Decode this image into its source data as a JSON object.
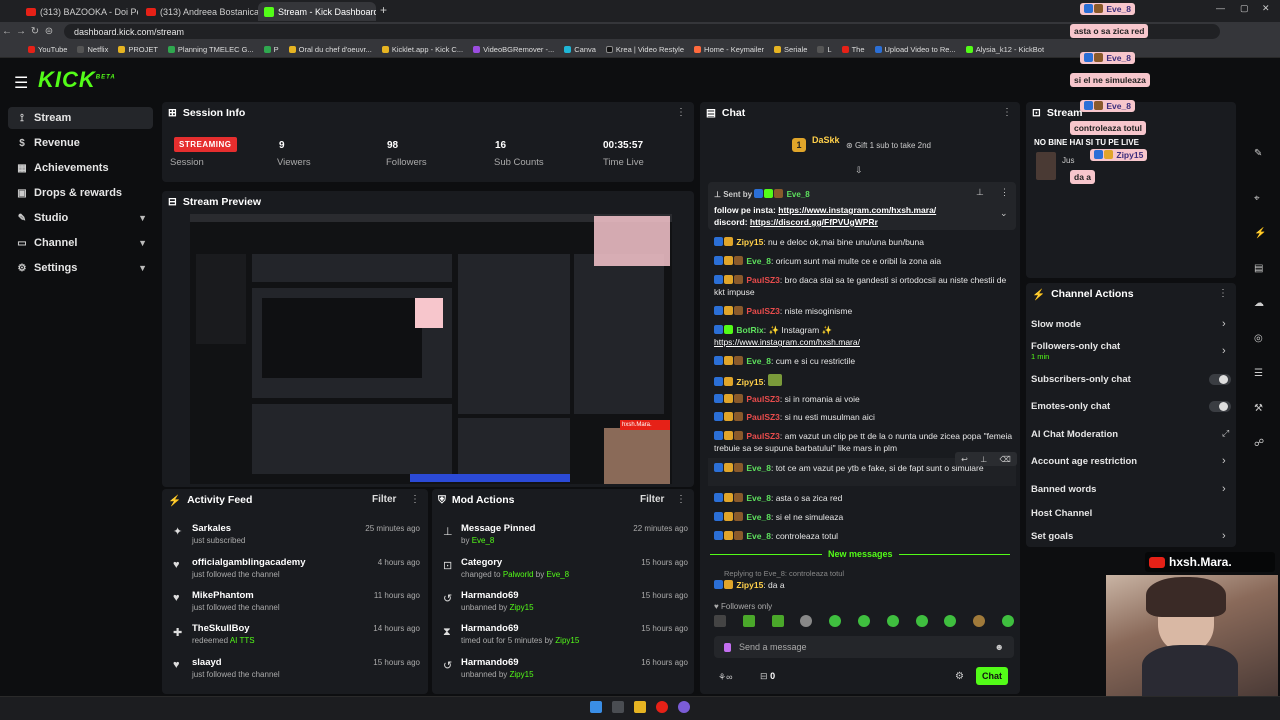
{
  "browser": {
    "tabs": [
      {
        "title": "(313) BAZOOKA - Doi Penali - Y"
      },
      {
        "title": "(313) Andreea Bostanica a Fos"
      },
      {
        "title": "Stream - Kick Dashboard"
      }
    ],
    "url": "dashboard.kick.com/stream",
    "bookmarks": [
      "YouTube",
      "Netflix",
      "PROJET",
      "Planning TMELEC G...",
      "P",
      "Oral du chef d'oeuvr...",
      "Kicklet.app - Kick C...",
      "VideoBGRemover -...",
      "Canva",
      "Krea | Video Restyle",
      "Home - Keymailer",
      "Seriale",
      "L",
      "The",
      "Upload Video to Re...",
      "Alysia_k12 - KickBot"
    ]
  },
  "logo": {
    "text": "KICK",
    "sup": "BETA"
  },
  "sidebar": [
    {
      "label": "Stream",
      "icon": "stream-icon"
    },
    {
      "label": "Revenue",
      "icon": "dollar-icon"
    },
    {
      "label": "Achievements",
      "icon": "trophy-icon"
    },
    {
      "label": "Drops & rewards",
      "icon": "gift-icon"
    },
    {
      "label": "Studio",
      "icon": "brush-icon"
    },
    {
      "label": "Channel",
      "icon": "tv-icon"
    },
    {
      "label": "Settings",
      "icon": "gear-icon"
    }
  ],
  "session": {
    "title": "Session Info",
    "status": "STREAMING",
    "status_label": "Session",
    "viewers": "9",
    "viewers_label": "Viewers",
    "followers": "98",
    "followers_label": "Followers",
    "subs": "16",
    "subs_label": "Sub Counts",
    "time": "00:35:57",
    "time_label": "Time Live"
  },
  "preview": {
    "title": "Stream Preview",
    "overlay_name": "hxsh.Mara."
  },
  "activity": {
    "title": "Activity Feed",
    "filter": "Filter",
    "items": [
      {
        "name": "Sarkales",
        "sub": "just subscribed",
        "time": "25 minutes ago"
      },
      {
        "name": "officialgamblingacademy",
        "sub": "just followed the channel",
        "time": "4 hours ago"
      },
      {
        "name": "MikePhantom",
        "sub": "just followed the channel",
        "time": "11 hours ago"
      },
      {
        "name": "TheSkullBoy",
        "sub": "redeemed",
        "sub2": "AI TTS",
        "time": "14 hours ago"
      },
      {
        "name": "slaayd",
        "sub": "just followed the channel",
        "time": "15 hours ago"
      }
    ]
  },
  "mod": {
    "title": "Mod Actions",
    "filter": "Filter",
    "items": [
      {
        "name": "Message Pinned",
        "sub": "by",
        "who": "Eve_8",
        "time": "22 minutes ago"
      },
      {
        "name": "Category",
        "sub": "changed to",
        "cat": "Palworld",
        "sub3": "by",
        "who": "Eve_8",
        "time": "15 hours ago"
      },
      {
        "name": "Harmando69",
        "sub": "unbanned by",
        "who": "Zipy15",
        "time": "15 hours ago"
      },
      {
        "name": "Harmando69",
        "sub": "timed out for 5 minutes by",
        "who": "Zipy15",
        "time": "15 hours ago"
      },
      {
        "name": "Harmando69",
        "sub": "unbanned by",
        "who": "Zipy15",
        "time": "16 hours ago"
      }
    ]
  },
  "chat": {
    "title": "Chat",
    "gifter": "DaSkk",
    "gifter_count": "1",
    "gift_text": "Gift 1 sub to take 2nd",
    "pinned_by_label": "Sent by",
    "pinned_by": "Eve_8",
    "pinned_text1": "follow pe insta:",
    "pinned_link1": "https://www.instagram.com/hxsh.mara/",
    "pinned_text2": "discord:",
    "pinned_link2": "https://discord.gg/FfPVUgWPRr",
    "messages": [
      {
        "user": "Zipy15",
        "text": ": nu e deloc ok,mai bine unu/una bun/buna"
      },
      {
        "user": "Eve_8",
        "text": ": oricum sunt mai multe ce e oribil la zona aia"
      },
      {
        "user": "PaulSZ3",
        "text": ": bro daca stai sa te gandesti si ortodocsii au niste chestii de kkt impuse"
      },
      {
        "user": "PaulSZ3",
        "text": ": niste misoginisme"
      },
      {
        "user": "BotRix",
        "text": ": ✨ Instagram ✨",
        "link": "https://www.instagram.com/hxsh.mara/"
      },
      {
        "user": "Eve_8",
        "text": ": cum e si cu restrictile"
      },
      {
        "user": "Zipy15",
        "text": ":"
      },
      {
        "user": "PaulSZ3",
        "text": ": si in romania ai voie"
      },
      {
        "user": "PaulSZ3",
        "text": ": si nu esti musulman aici"
      },
      {
        "user": "PaulSZ3",
        "text": ": am vazut un clip pe tt de la o nunta unde zicea popa \"femeia trebuie sa se supuna barbatului\" like mars in plm"
      },
      {
        "user": "Eve_8",
        "text": ": tot ce am vazut pe ytb e fake, si de fapt sunt o simulare"
      },
      {
        "user": "Eve_8",
        "text": ": asta o sa zica red"
      },
      {
        "user": "Eve_8",
        "text": ": si el ne simuleaza"
      },
      {
        "user": "Eve_8",
        "text": ": controleaza totul"
      }
    ],
    "new_messages": "New messages",
    "replying_to": "Replying to Eve_8: controleaza totul",
    "reply_user": "Zipy15",
    "reply_text": ": da a",
    "followers_only": "Followers only",
    "input_placeholder": "Send a message",
    "points": "0",
    "chat_button": "Chat"
  },
  "stream_panel": {
    "title": "Stream",
    "text": "NO BINE HAI SI TU PE LIVE",
    "sub": "Jus"
  },
  "channel_actions": {
    "title": "Channel Actions",
    "items": [
      {
        "label": "Slow mode"
      },
      {
        "label": "Followers-only chat",
        "sub": "1 min"
      },
      {
        "label": "Subscribers-only chat"
      },
      {
        "label": "Emotes-only chat"
      },
      {
        "label": "AI Chat Moderation"
      },
      {
        "label": "Account age restriction"
      },
      {
        "label": "Banned words"
      },
      {
        "label": "Host Channel"
      },
      {
        "label": "Set goals"
      }
    ]
  },
  "overlay_chat": [
    {
      "user": "Eve_8",
      "text": "asta o sa zica red"
    },
    {
      "user": "Eve_8",
      "text": "si el ne simuleaza"
    },
    {
      "user": "Eve_8",
      "text": "controleaza totul"
    },
    {
      "user": "Zipy15",
      "text": "da a"
    }
  ],
  "webcam": {
    "name": "hxsh.Mara."
  }
}
